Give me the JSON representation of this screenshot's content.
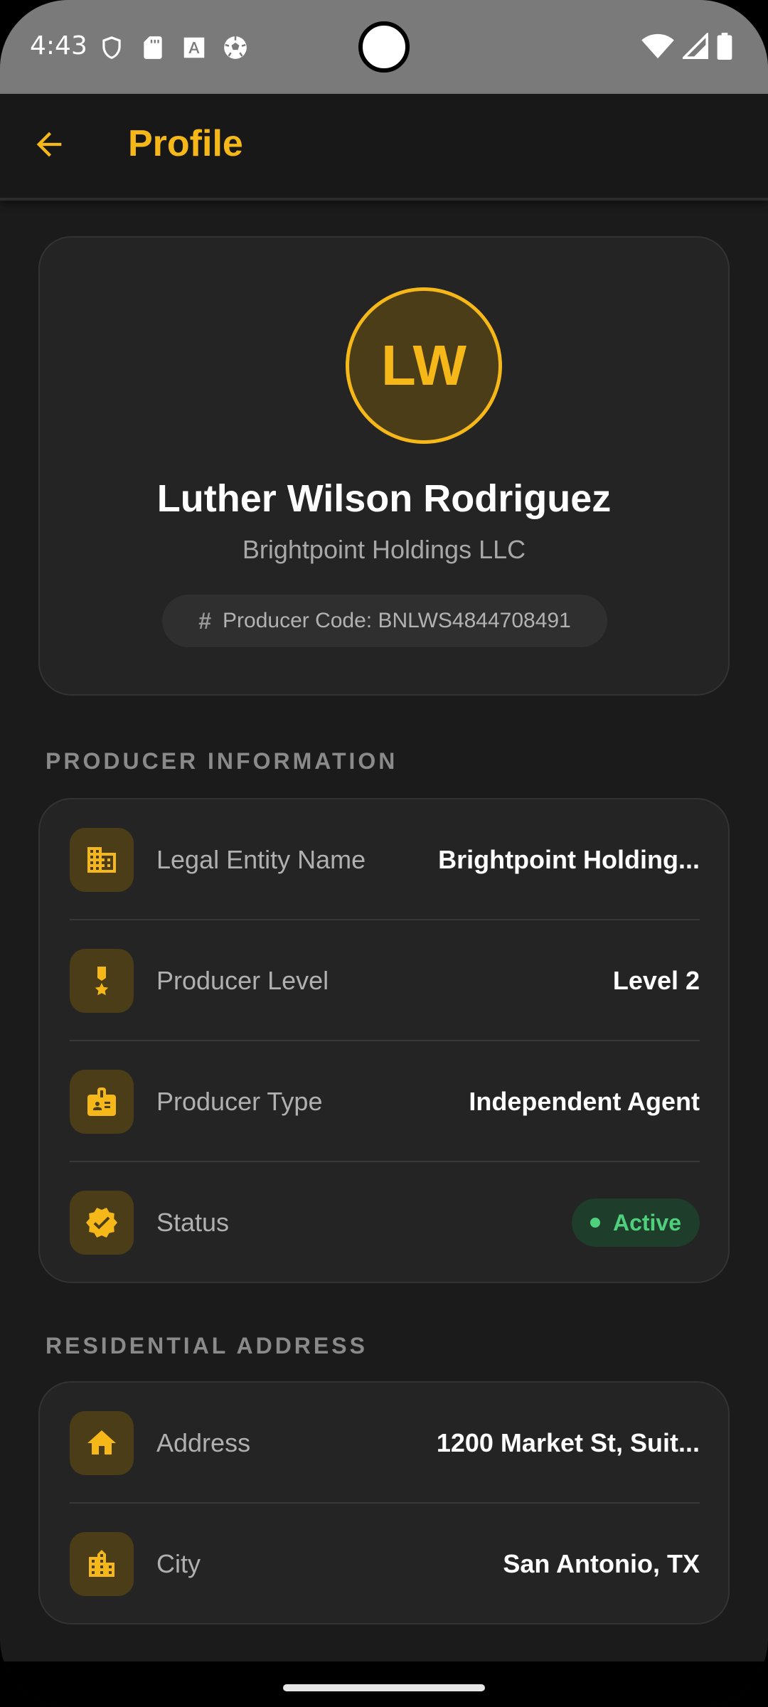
{
  "status_bar": {
    "time": "4:43",
    "left_icons": [
      "shield-icon",
      "sd-card-icon",
      "font-icon",
      "soccer-ball-icon"
    ],
    "right_icons": [
      "wifi-icon",
      "signal-icon",
      "battery-icon"
    ]
  },
  "app_bar": {
    "back_icon": "arrow-back-icon",
    "title": "Profile"
  },
  "profile": {
    "initials": "LW",
    "name": "Luther Wilson Rodriguez",
    "company": "Brightpoint Holdings LLC",
    "producer_code_icon": "#",
    "producer_code": "Producer Code: BNLWS4844708491"
  },
  "sections": {
    "producer_info": {
      "title": "PRODUCER INFORMATION",
      "rows": [
        {
          "icon": "building-icon",
          "label": "Legal Entity Name",
          "value": "Brightpoint Holding..."
        },
        {
          "icon": "medal-icon",
          "label": "Producer Level",
          "value": "Level 2"
        },
        {
          "icon": "badge-icon",
          "label": "Producer Type",
          "value": "Independent Agent"
        },
        {
          "icon": "verified-icon",
          "label": "Status",
          "value": "Active"
        }
      ]
    },
    "residential_address": {
      "title": "RESIDENTIAL ADDRESS",
      "rows": [
        {
          "icon": "home-icon",
          "label": "Address",
          "value": "1200 Market St, Suit..."
        },
        {
          "icon": "city-icon",
          "label": "City",
          "value": "San Antonio, TX"
        }
      ]
    }
  },
  "colors": {
    "accent": "#f5b818",
    "status_active": "#4ed07c",
    "background": "#1b1b1b",
    "card": "#242424"
  }
}
